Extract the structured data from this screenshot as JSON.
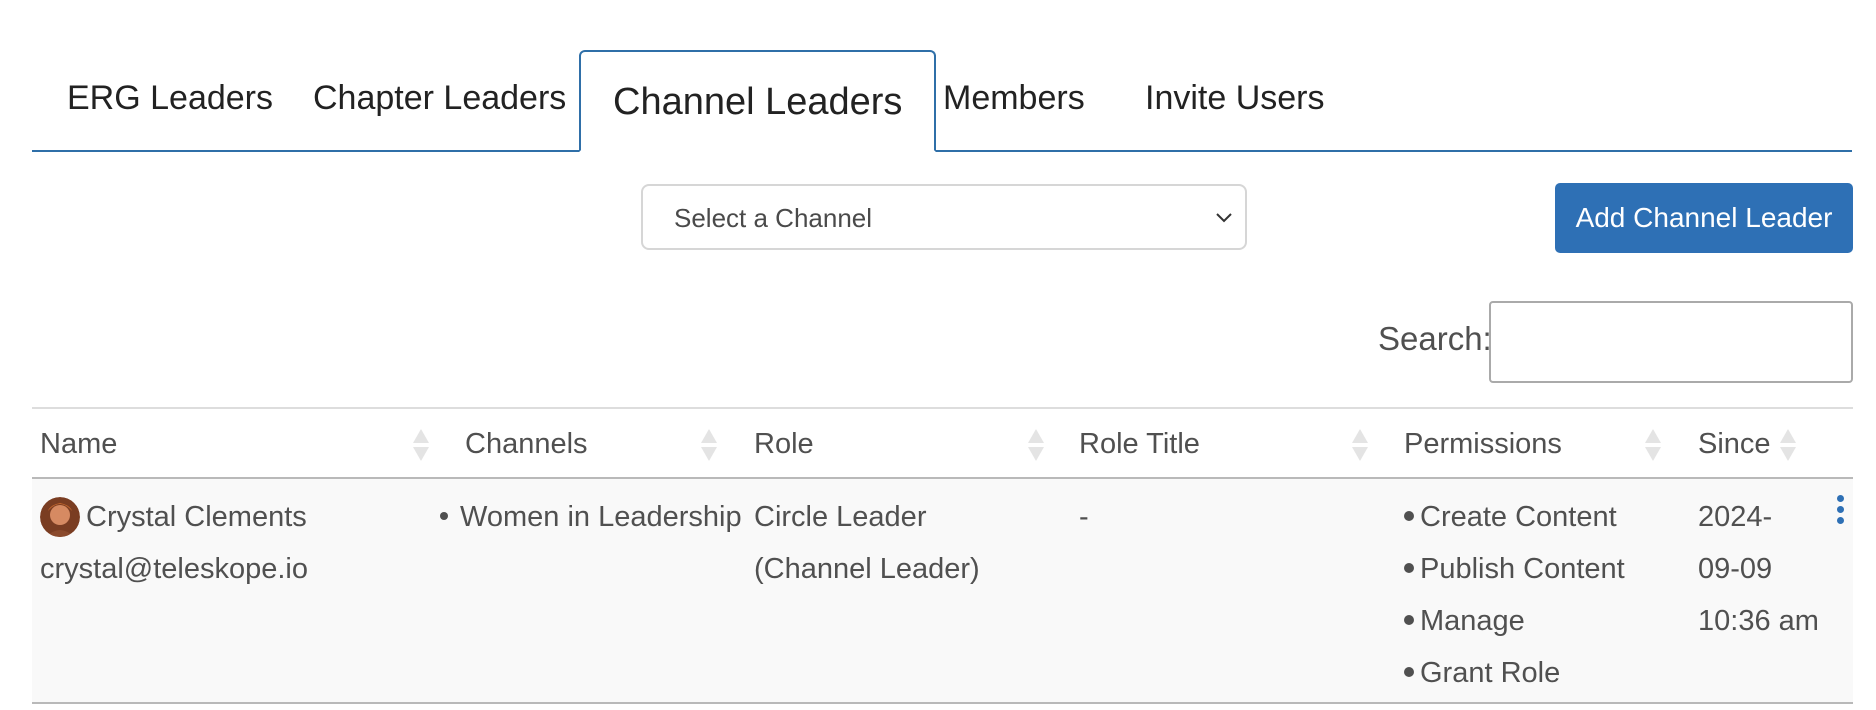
{
  "tabs": [
    {
      "label": "ERG Leaders",
      "active": false
    },
    {
      "label": "Chapter Leaders",
      "active": false
    },
    {
      "label": "Channel Leaders",
      "active": true
    },
    {
      "label": "Members",
      "active": false
    },
    {
      "label": "Invite Users",
      "active": false
    }
  ],
  "channel_select": {
    "value": "Select a Channel"
  },
  "add_button": {
    "label": "Add Channel Leader"
  },
  "search": {
    "label": "Search:",
    "value": ""
  },
  "table": {
    "columns": [
      "Name",
      "Channels",
      "Role",
      "Role Title",
      "Permissions",
      "Since"
    ],
    "rows": [
      {
        "name": "Crystal Clements",
        "email": "crystal@teleskope.io",
        "channels": [
          "Women in Leadership"
        ],
        "role_line1": "Circle Leader",
        "role_line2": "(Channel Leader)",
        "role_title": "-",
        "permissions": [
          "Create Content",
          "Publish Content",
          "Manage",
          "Grant Role"
        ],
        "since_line1": "2024-",
        "since_line2": "09-09",
        "since_line3": "10:36 am"
      }
    ]
  },
  "colors": {
    "accent": "#2e70b5",
    "tab_border": "#2f6fa8"
  }
}
